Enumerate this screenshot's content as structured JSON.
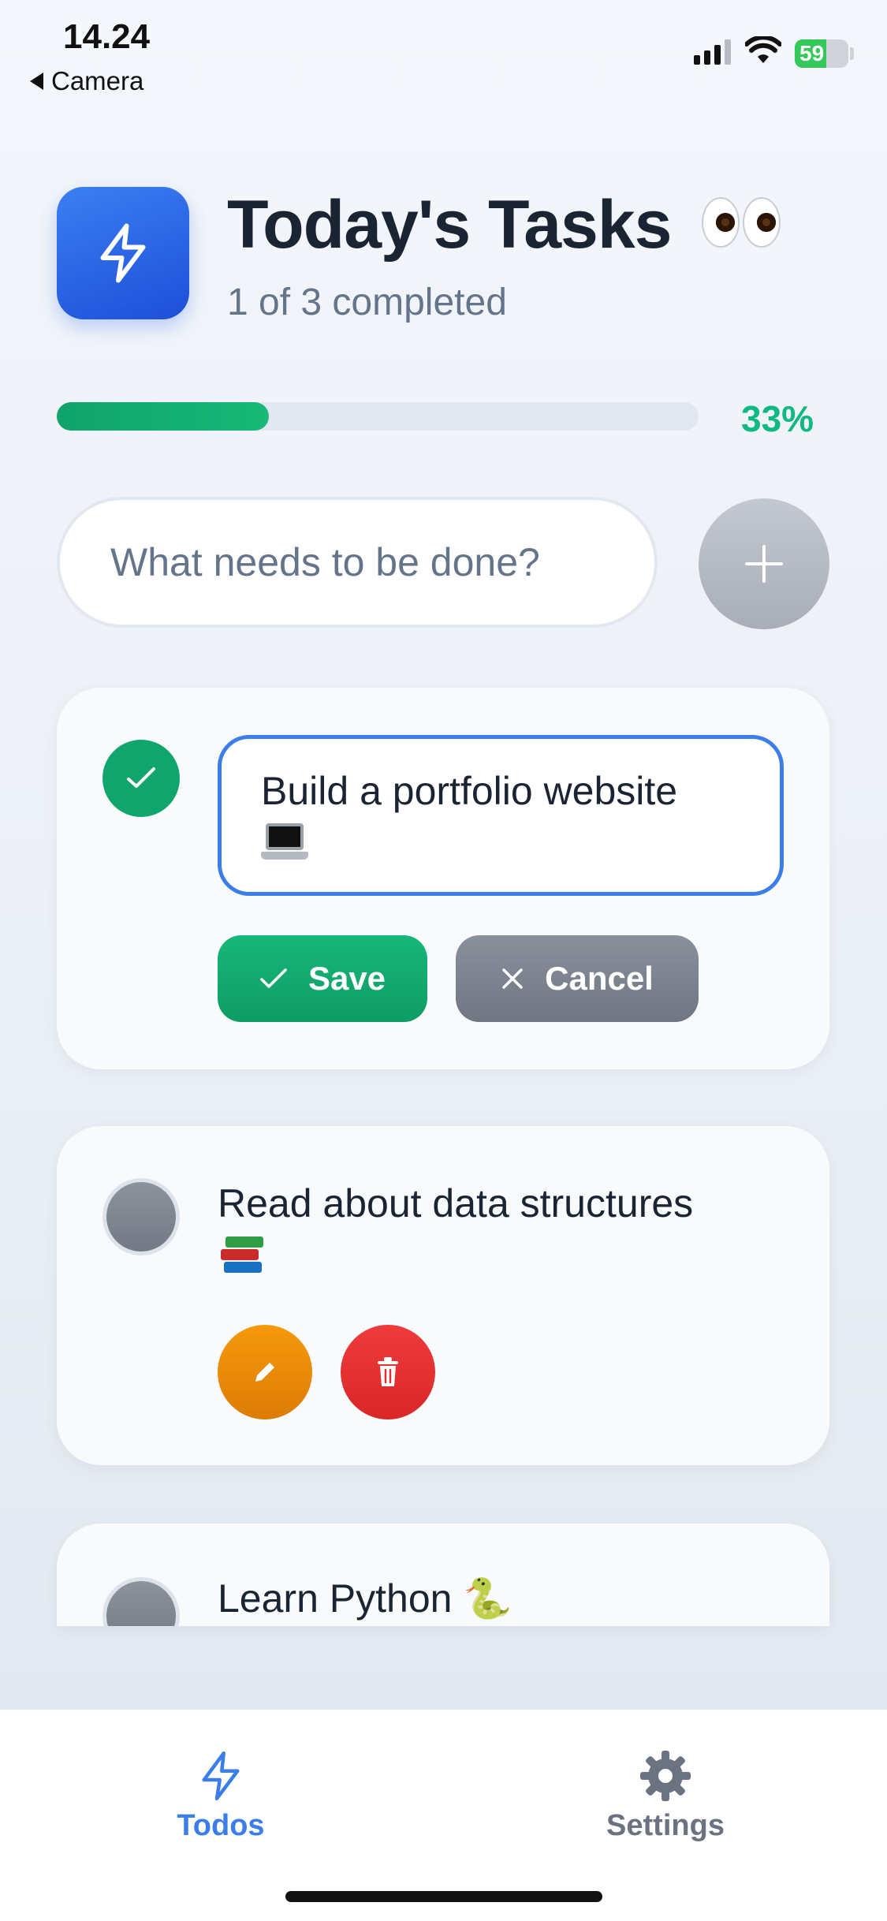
{
  "status_bar": {
    "time": "14.24",
    "back_label": "Camera",
    "battery": "59"
  },
  "header": {
    "title": "Today's Tasks",
    "title_emoji": "eyes-emoji",
    "subtitle": "1 of 3 completed"
  },
  "progress": {
    "percent_label": "33%",
    "value": 0.33,
    "color": "#10b981"
  },
  "new_task": {
    "placeholder": "What needs to be done?",
    "add_icon": "plus-icon"
  },
  "tasks": [
    {
      "text": "Build a portfolio website",
      "emoji": "laptop-emoji",
      "completed": true,
      "editing": true,
      "save_label": "Save",
      "cancel_label": "Cancel"
    },
    {
      "text": "Read about data structures",
      "emoji": "books-emoji",
      "completed": false,
      "editing": false
    },
    {
      "text": "Learn Python 🐍",
      "completed": false,
      "editing": false
    }
  ],
  "tab_bar": {
    "todos_label": "Todos",
    "settings_label": "Settings",
    "active": "Todos",
    "accent": "#3b7de9"
  },
  "colors": {
    "primary": "#2563eb",
    "success": "#10b981",
    "warning": "#f59e0b",
    "danger": "#ef4444"
  }
}
